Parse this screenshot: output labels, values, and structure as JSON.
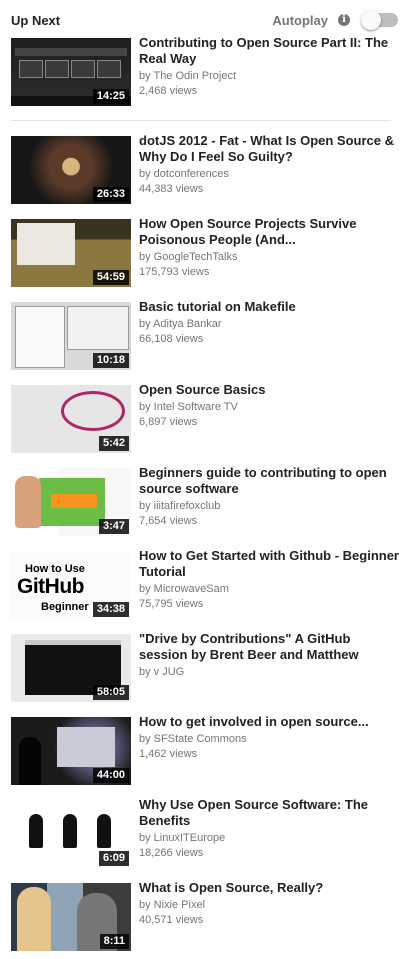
{
  "header": {
    "up_next": "Up Next",
    "autoplay_label": "Autoplay",
    "info_glyph": "i",
    "autoplay_on": false
  },
  "videos": [
    {
      "title": "Contributing to Open Source Part II: The Real Way",
      "channel": "by The Odin Project",
      "views": "2,468 views",
      "duration": "14:25",
      "thumb": "odin"
    },
    {
      "title": "dotJS 2012 - Fat - What Is Open Source & Why Do I Feel So Guilty?",
      "channel": "by dotconferences",
      "views": "44,383 views",
      "duration": "26:33",
      "thumb": "dotjs"
    },
    {
      "title": "How Open Source Projects Survive Poisonous People (And...",
      "channel": "by GoogleTechTalks",
      "views": "175,793 views",
      "duration": "54:59",
      "thumb": "google"
    },
    {
      "title": "Basic tutorial on Makefile",
      "channel": "by Aditya Bankar",
      "views": "66,108 views",
      "duration": "10:18",
      "thumb": "make"
    },
    {
      "title": "Open Source Basics",
      "channel": "by Intel Software TV",
      "views": "6,897 views",
      "duration": "5:42",
      "thumb": "oss"
    },
    {
      "title": "Beginners guide to contributing to open source software",
      "channel": "by iiitafirefoxclub",
      "views": "7,654 views",
      "duration": "3:47",
      "thumb": "gsoc"
    },
    {
      "title": "How to Get Started with Github - Beginner Tutorial",
      "channel": "by MicrowaveSam",
      "views": "75,795 views",
      "duration": "34:38",
      "thumb": "github"
    },
    {
      "title": "\"Drive by Contributions\" A GitHub session by Brent Beer and Matthew",
      "channel": "by v JUG",
      "views": "",
      "duration": "58:05",
      "thumb": "drive"
    },
    {
      "title": "How to get involved in open source...",
      "channel": "by SFState Commons",
      "views": "1,462 views",
      "duration": "44:00",
      "thumb": "sfstate"
    },
    {
      "title": "Why Use Open Source Software: The Benefits",
      "channel": "by LinuxITEurope",
      "views": "18,266 views",
      "duration": "6:09",
      "thumb": "linux"
    },
    {
      "title": "What is Open Source, Really?",
      "channel": "by Nixie Pixel",
      "views": "40,571 views",
      "duration": "8:11",
      "thumb": "nixie"
    }
  ],
  "thumb_text": {
    "github_line1": "How to Use",
    "github_line2": "GitHub",
    "github_line3": "Beginner"
  }
}
